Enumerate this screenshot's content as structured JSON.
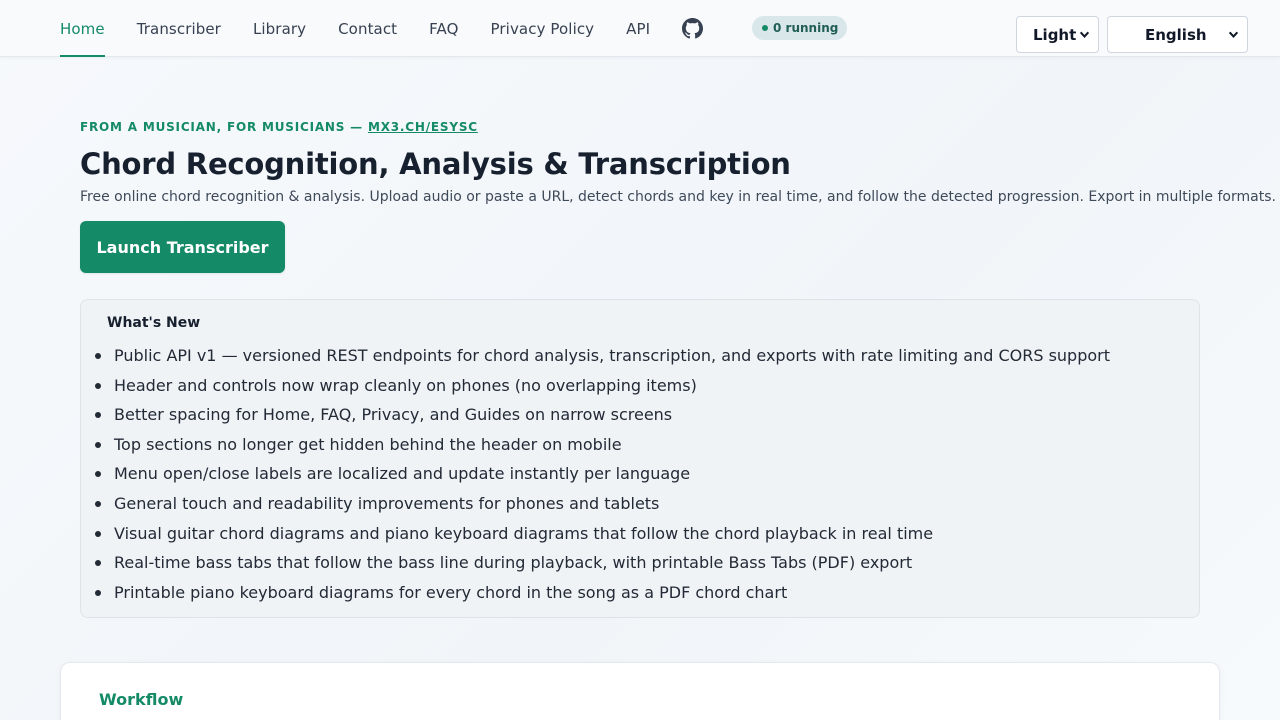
{
  "nav": {
    "items": [
      {
        "label": "Home",
        "active": true
      },
      {
        "label": "Transcriber",
        "active": false
      },
      {
        "label": "Library",
        "active": false
      },
      {
        "label": "Contact",
        "active": false
      },
      {
        "label": "FAQ",
        "active": false
      },
      {
        "label": "Privacy Policy",
        "active": false
      },
      {
        "label": "API",
        "active": false
      }
    ],
    "github_icon": "github-icon"
  },
  "status": {
    "running": "0 running"
  },
  "controls": {
    "theme": "Light",
    "language": "English"
  },
  "hero": {
    "eyebrow": "FROM A MUSICIAN, FOR MUSICIANS — ",
    "eyebrow_link": "MX3.CH/ESYSC",
    "title": "Chord Recognition, Analysis & Transcription",
    "subtitle": "Free online chord recognition & analysis. Upload audio or paste a URL, detect chords and key in real time, and follow the detected progression. Export in multiple formats.",
    "cta": "Launch Transcriber"
  },
  "whats_new": {
    "heading": "What's New",
    "items": [
      "Public API v1 — versioned REST endpoints for chord analysis, transcription, and exports with rate limiting and CORS support",
      "Header and controls now wrap cleanly on phones (no overlapping items)",
      "Better spacing for Home, FAQ, Privacy, and Guides on narrow screens",
      "Top sections no longer get hidden behind the header on mobile",
      "Menu open/close labels are localized and update instantly per language",
      "General touch and readability improvements for phones and tablets",
      "Visual guitar chord diagrams and piano keyboard diagrams that follow the chord playback in real time",
      "Real-time bass tabs that follow the bass line during playback, with printable Bass Tabs (PDF) export",
      "Printable piano keyboard diagrams for every chord in the song as a PDF chord chart"
    ]
  },
  "workflow": {
    "heading": "Workflow"
  },
  "colors": {
    "accent": "#148a66",
    "text": "#17202e"
  }
}
